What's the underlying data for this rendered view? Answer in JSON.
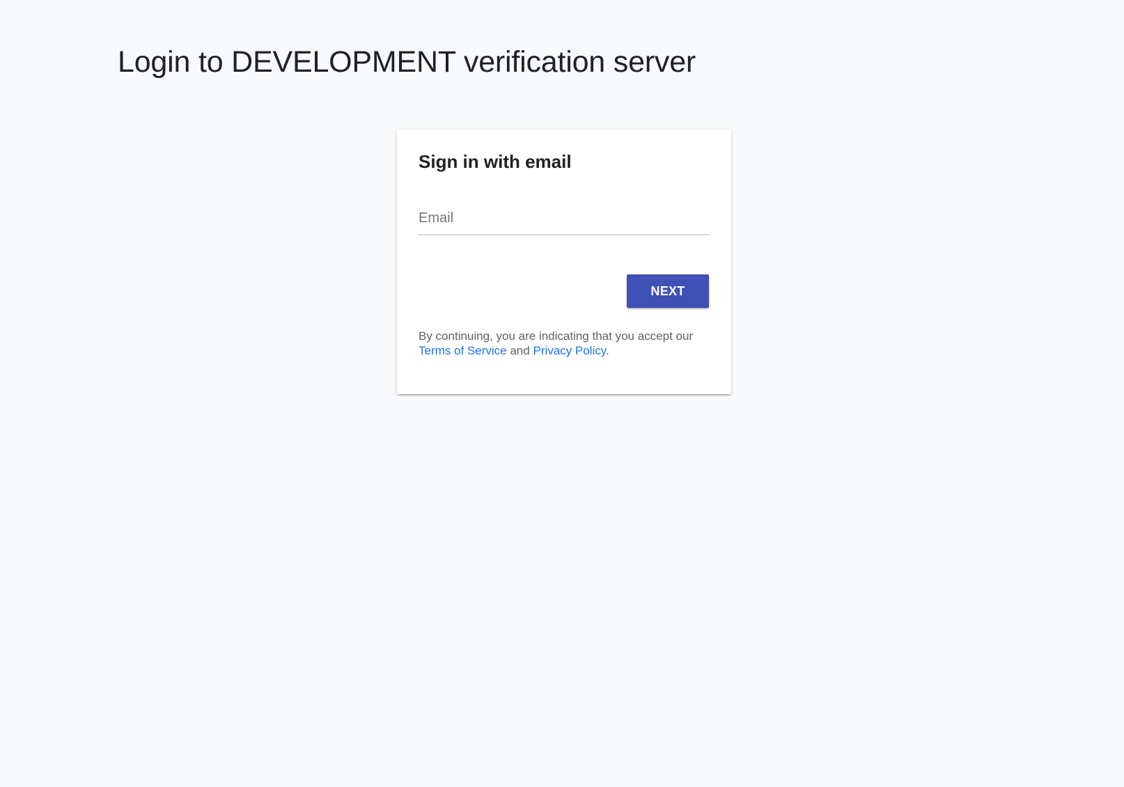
{
  "page": {
    "title": "Login to DEVELOPMENT verification server"
  },
  "card": {
    "title": "Sign in with email",
    "email": {
      "placeholder": "Email",
      "value": ""
    },
    "next_label": "NEXT",
    "legal": {
      "prefix": "By continuing, you are indicating that you accept our",
      "terms_label": "Terms of Service",
      "conjunction": "and",
      "privacy_label": "Privacy Policy",
      "suffix": "."
    }
  },
  "colors": {
    "background": "#f8f9fa",
    "primary_button": "#3f51b5",
    "link": "#1a73e8"
  }
}
